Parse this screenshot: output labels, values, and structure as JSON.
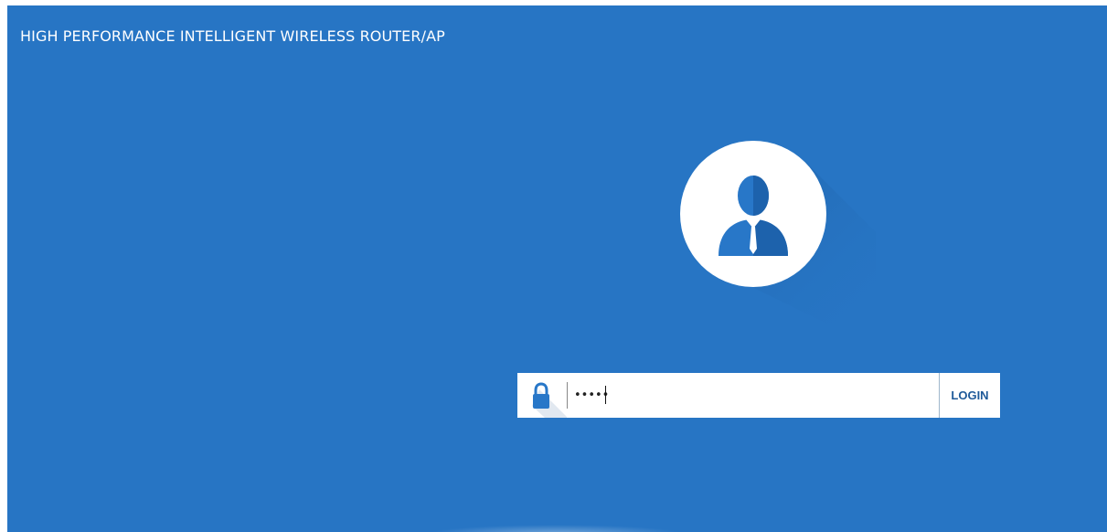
{
  "header": {
    "title": "HIGH PERFORMANCE INTELLIGENT WIRELESS ROUTER/AP"
  },
  "login": {
    "password_value": "•••••",
    "button_label": "LOGIN"
  },
  "icons": {
    "avatar": "user-avatar-icon",
    "lock": "lock-icon"
  },
  "colors": {
    "background": "#2775c4",
    "accent": "#2877c8",
    "button_text": "#1f5a99"
  }
}
